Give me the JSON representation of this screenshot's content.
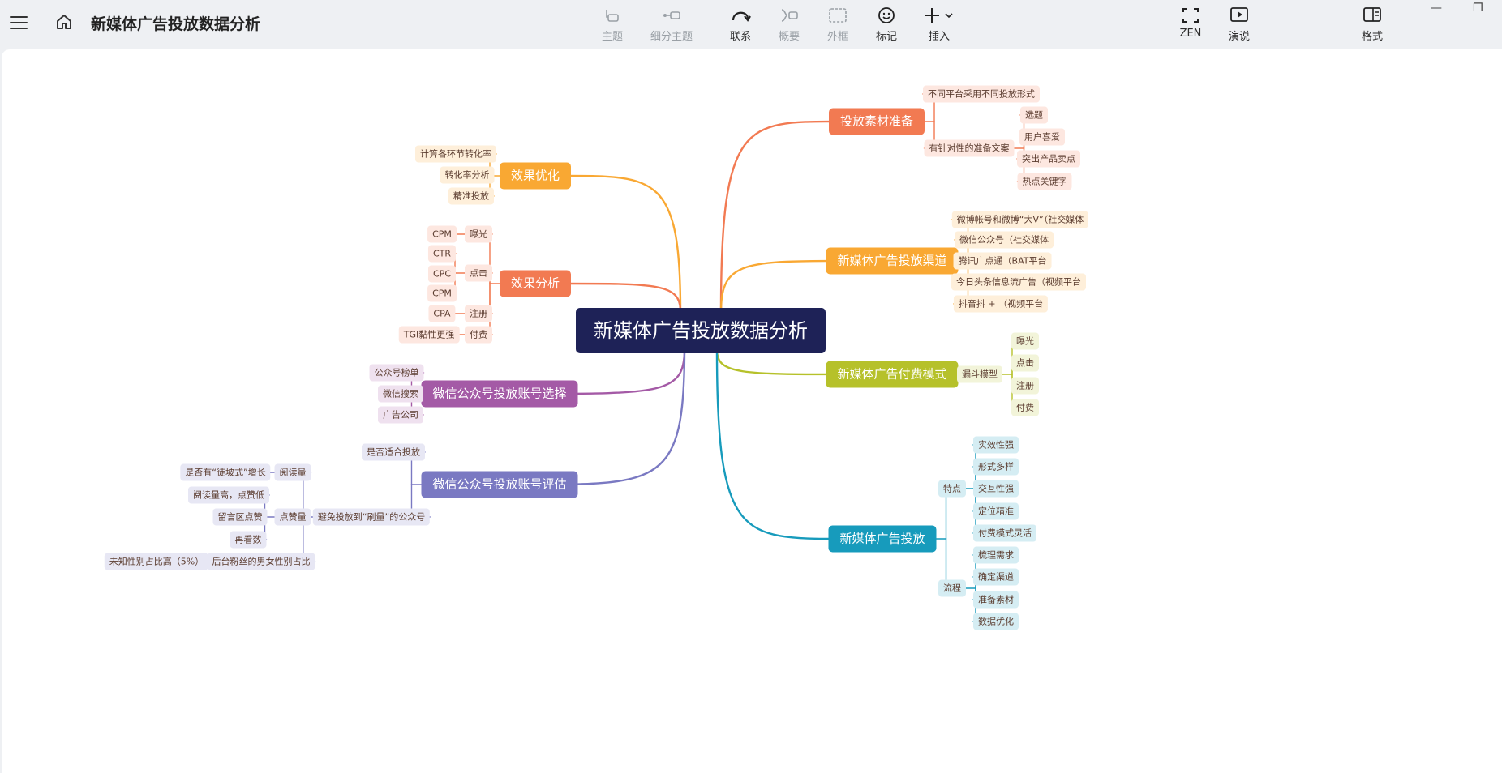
{
  "toolbar": {
    "doc_title": "新媒体广告投放数据分析",
    "topic": "主题",
    "subtopic": "细分主题",
    "relation": "联系",
    "summary": "概要",
    "boundary": "外框",
    "marker": "标记",
    "insert": "插入",
    "zen": "ZEN",
    "present": "演说",
    "format": "格式"
  },
  "window": {
    "minimize": "—",
    "restore": "❐"
  },
  "mindmap": {
    "root": "新媒体广告投放数据分析",
    "colors": {
      "orange_red": "#f27a52",
      "amber": "#f9a833",
      "olive": "#b6c12a",
      "teal": "#179bbc",
      "purple": "#a45aa6",
      "violet": "#7a79c2"
    },
    "right": [
      {
        "label": "投放素材准备",
        "color": "#f27a52",
        "children": [
          {
            "label": "不同平台采用不同投放形式"
          },
          {
            "label": "有针对性的准备文案",
            "children": [
              "选题",
              "用户喜爱",
              "突出产品卖点",
              "热点关键字"
            ]
          }
        ]
      },
      {
        "label": "新媒体广告投放渠道",
        "color": "#f9a833",
        "children": [
          {
            "label": "微博帐号和微博“大V”（社交媒体"
          },
          {
            "label": "微信公众号（社交媒体"
          },
          {
            "label": "腾讯广点通（BAT平台"
          },
          {
            "label": "今日头条信息流广告（视频平台"
          },
          {
            "label": "抖音抖 + （视频平台"
          }
        ]
      },
      {
        "label": "新媒体广告付费模式",
        "color": "#b6c12a",
        "children": [
          {
            "label": "漏斗模型",
            "children": [
              "曝光",
              "点击",
              "注册",
              "付费"
            ]
          }
        ]
      },
      {
        "label": "新媒体广告投放",
        "color": "#179bbc",
        "children": [
          {
            "label": "特点",
            "children": [
              "实效性强",
              "形式多样",
              "交互性强",
              "定位精准",
              "付费模式灵活"
            ]
          },
          {
            "label": "流程",
            "children": [
              "梳理需求",
              "确定渠道",
              "准备素材",
              "数据优化"
            ]
          }
        ]
      }
    ],
    "left": [
      {
        "label": "效果优化",
        "color": "#f9a833",
        "children": [
          {
            "label": "计算各环节转化率"
          },
          {
            "label": "转化率分析"
          },
          {
            "label": "精准投放"
          }
        ]
      },
      {
        "label": "效果分析",
        "color": "#f27a52",
        "children": [
          {
            "label": "曝光",
            "children": [
              "CPM"
            ]
          },
          {
            "label": "点击",
            "children": [
              "CTR",
              "CPC",
              "CPM"
            ]
          },
          {
            "label": "注册",
            "children": [
              "CPA"
            ]
          },
          {
            "label": "付费",
            "children": [
              "TGI黏性更强"
            ]
          }
        ]
      },
      {
        "label": "微信公众号投放账号选择",
        "color": "#a45aa6",
        "children": [
          {
            "label": "公众号榜单"
          },
          {
            "label": "微信搜索"
          },
          {
            "label": "广告公司"
          }
        ]
      },
      {
        "label": "微信公众号投放账号评估",
        "color": "#7a79c2",
        "children": [
          {
            "label": "是否适合投放"
          },
          {
            "label": "避免投放到“刷量”的公众号",
            "children": [
              {
                "label": "阅读量",
                "children": [
                  "是否有“徒坡式”增长"
                ]
              },
              {
                "label": "点赞量",
                "children": [
                  "阅读量高，点赞低",
                  "留言区点赞",
                  "再看数"
                ]
              },
              {
                "label": "后台粉丝的男女性别占比",
                "children": [
                  "未知性别占比高（5%）"
                ]
              }
            ]
          }
        ]
      }
    ]
  }
}
